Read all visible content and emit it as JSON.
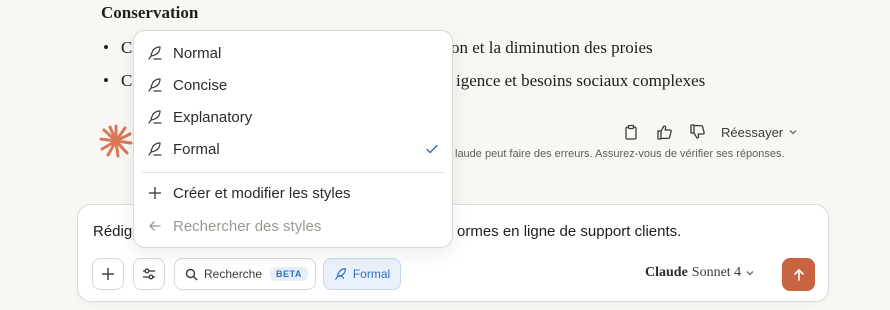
{
  "conversation": {
    "section_title": "Conservation",
    "bullets": [
      {
        "start": "C",
        "end": "on et la diminution des proies"
      },
      {
        "start": "C",
        "end": "igence et besoins sociaux complexes"
      }
    ]
  },
  "message_actions": {
    "retry_label": "Réessayer",
    "disclaimer": "laude peut faire des erreurs. Assurez-vous de vérifier ses réponses."
  },
  "style_menu": {
    "items": [
      {
        "label": "Normal",
        "icon": "quill-icon"
      },
      {
        "label": "Concise",
        "icon": "quill-icon"
      },
      {
        "label": "Explanatory",
        "icon": "quill-icon"
      },
      {
        "label": "Formal",
        "icon": "quill-icon",
        "selected": true
      }
    ],
    "create_label": "Créer et modifier les styles",
    "search_label": "Rechercher des styles"
  },
  "composer": {
    "text_start": "Rédig",
    "text_end": "ormes en ligne de support clients.",
    "search_label": "Recherche",
    "beta_label": "BETA",
    "style_label": "Formal",
    "model_brand": "Claude",
    "model_name": "Sonnet 4"
  },
  "colors": {
    "accent": "#c96442",
    "selected_blue": "#2f6fc4",
    "background": "#f8f7f4"
  }
}
